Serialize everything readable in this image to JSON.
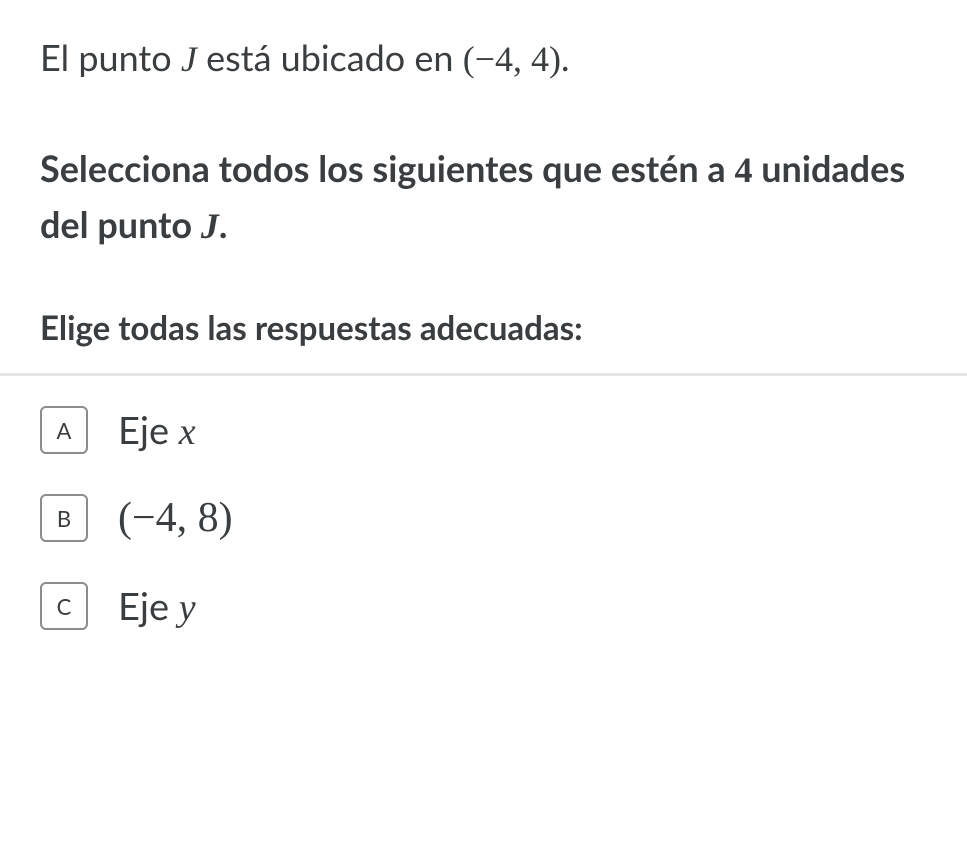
{
  "question": {
    "line1_pre": "El punto ",
    "line1_var": "J",
    "line1_mid": " está ubicado en ",
    "line1_coord": "(−4, 4)",
    "line1_end": ".",
    "line2_pre": "Selecciona todos los siguientes que estén a ",
    "line2_num": "4",
    "line2_mid": " unidades del punto ",
    "line2_var": "J",
    "line2_end": "."
  },
  "instruction": "Elige todas las respuestas adecuadas:",
  "choices": {
    "a": {
      "letter": "A",
      "text_pre": "Eje ",
      "text_var": "x"
    },
    "b": {
      "letter": "B",
      "text_coord": "(−4, 8)"
    },
    "c": {
      "letter": "C",
      "text_pre": "Eje ",
      "text_var": "y"
    }
  }
}
